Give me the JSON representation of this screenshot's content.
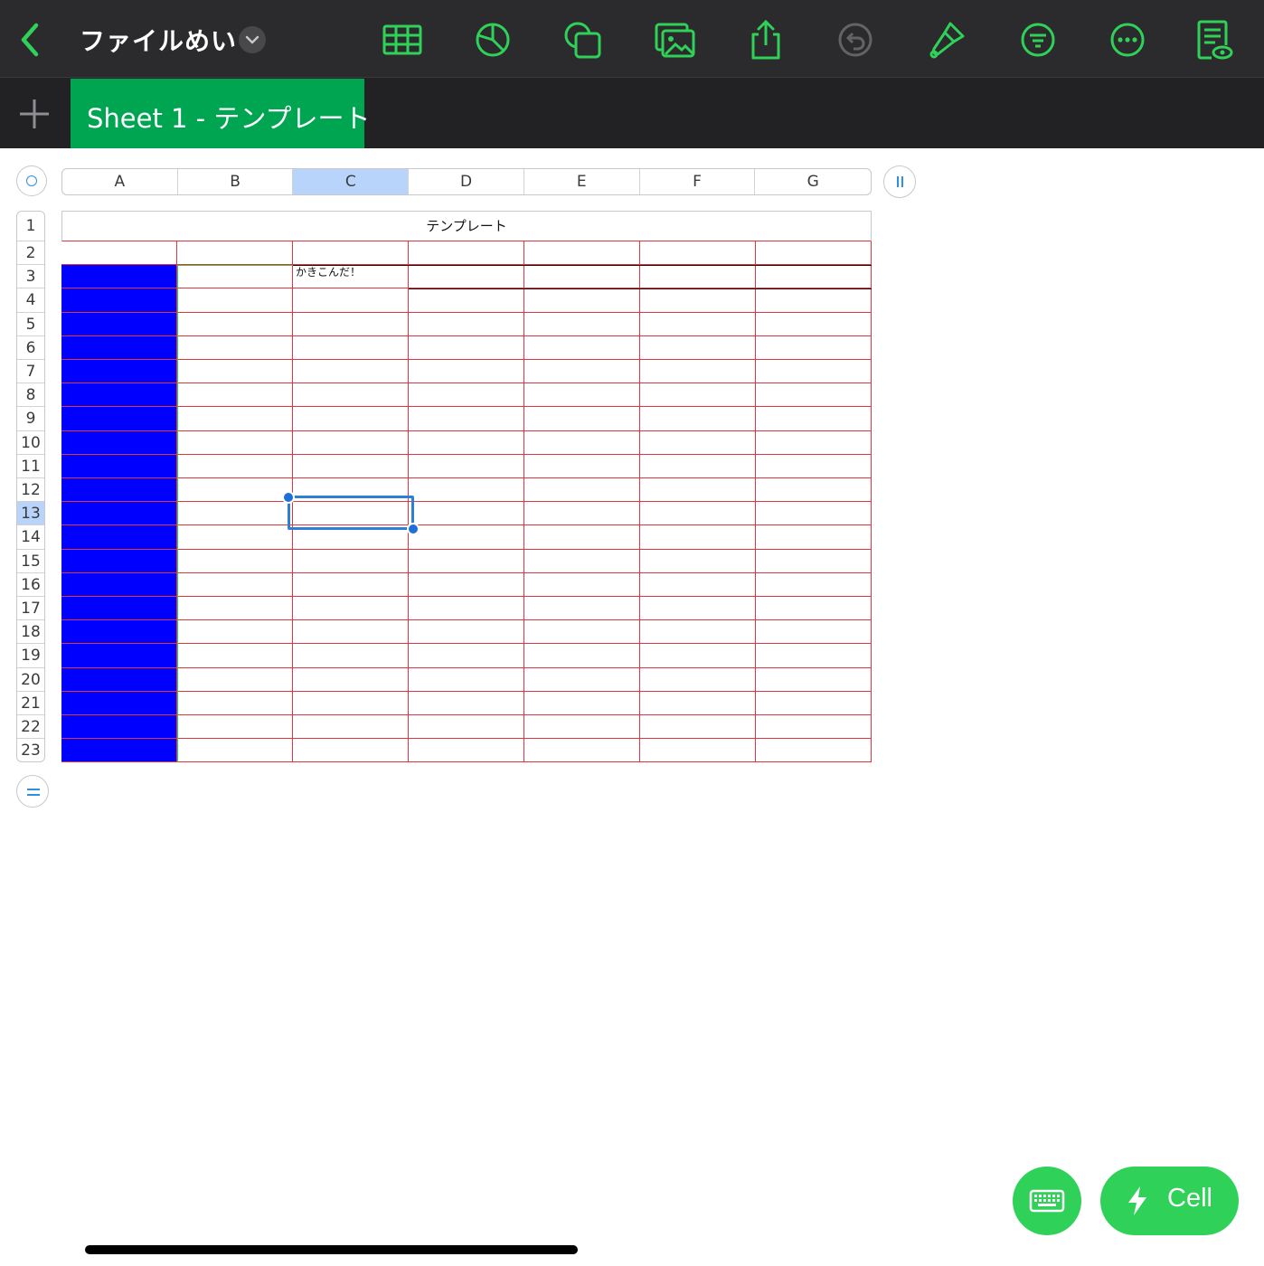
{
  "toolbar": {
    "back_icon": "chevron-left-icon",
    "document_title": "ファイルめい",
    "title_menu_icon": "chevron-down-icon",
    "tools": [
      "table-icon",
      "chart-icon",
      "shapes-icon",
      "media-icon",
      "share-icon",
      "undo-icon",
      "format-brush-icon",
      "organize-icon",
      "more-icon",
      "view-options-icon"
    ],
    "accent_color": "#30d158"
  },
  "tabs": {
    "add_icon": "plus-icon",
    "active_tab": "Sheet 1 - テンプレート",
    "active_tab_color": "#00a552"
  },
  "sheet": {
    "columns": [
      "A",
      "B",
      "C",
      "D",
      "E",
      "F",
      "G"
    ],
    "selected_column": "C",
    "rows": [
      "1",
      "2",
      "3",
      "4",
      "5",
      "6",
      "7",
      "8",
      "9",
      "10",
      "11",
      "12",
      "13",
      "14",
      "15",
      "16",
      "17",
      "18",
      "19",
      "20",
      "21",
      "22",
      "23"
    ],
    "selected_row": "13",
    "table_title": "テンプレート",
    "cell_c3": "かきこんだ！",
    "fill_color_col_a": "#0000ff",
    "grid_line_color": "#e0343f"
  },
  "floating": {
    "keyboard_icon": "keyboard-icon",
    "cell_button_icon": "lightning-icon",
    "cell_button_label": "Cell"
  }
}
